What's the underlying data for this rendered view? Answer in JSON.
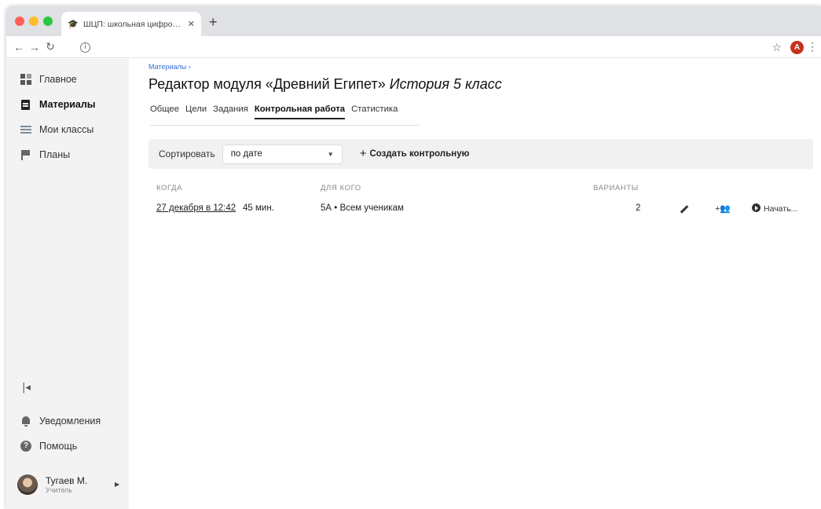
{
  "browser": {
    "tab_title": "ШЦП: школьная цифровая пл",
    "tab_close": "✕",
    "new_tab": "+",
    "profile_initial": "A"
  },
  "sidebar": {
    "items": [
      {
        "label": "Главное",
        "icon": "grid-icon"
      },
      {
        "label": "Материалы",
        "icon": "clipboard-icon",
        "active": true
      },
      {
        "label": "Мои классы",
        "icon": "table-icon"
      },
      {
        "label": "Планы",
        "icon": "flag-icon"
      }
    ],
    "notifications": "Уведомления",
    "help": "Помощь",
    "user_name": "Тугаев М.",
    "user_role": "Учитель"
  },
  "main": {
    "breadcrumb": "Материалы ›",
    "title": "Редактор модуля «Древний Египет»",
    "title_sub": "История 5 класс",
    "tabs": [
      {
        "label": "Общее"
      },
      {
        "label": "Цели"
      },
      {
        "label": "Задания"
      },
      {
        "label": "Контрольная работа",
        "active": true
      },
      {
        "label": "Статистика"
      }
    ],
    "sort_label": "Сортировать",
    "sort_value": "по дате",
    "create_label": "Создать контрольную",
    "columns": {
      "when": "КОГДА",
      "for_whom": "ДЛЯ КОГО",
      "variants": "ВАРИАНТЫ"
    },
    "rows": [
      {
        "date": "27 декабря в 12:42",
        "duration": "45 мин.",
        "for_whom": "5А • Всем ученикам",
        "variants": "2",
        "start": "Начать..."
      }
    ]
  }
}
